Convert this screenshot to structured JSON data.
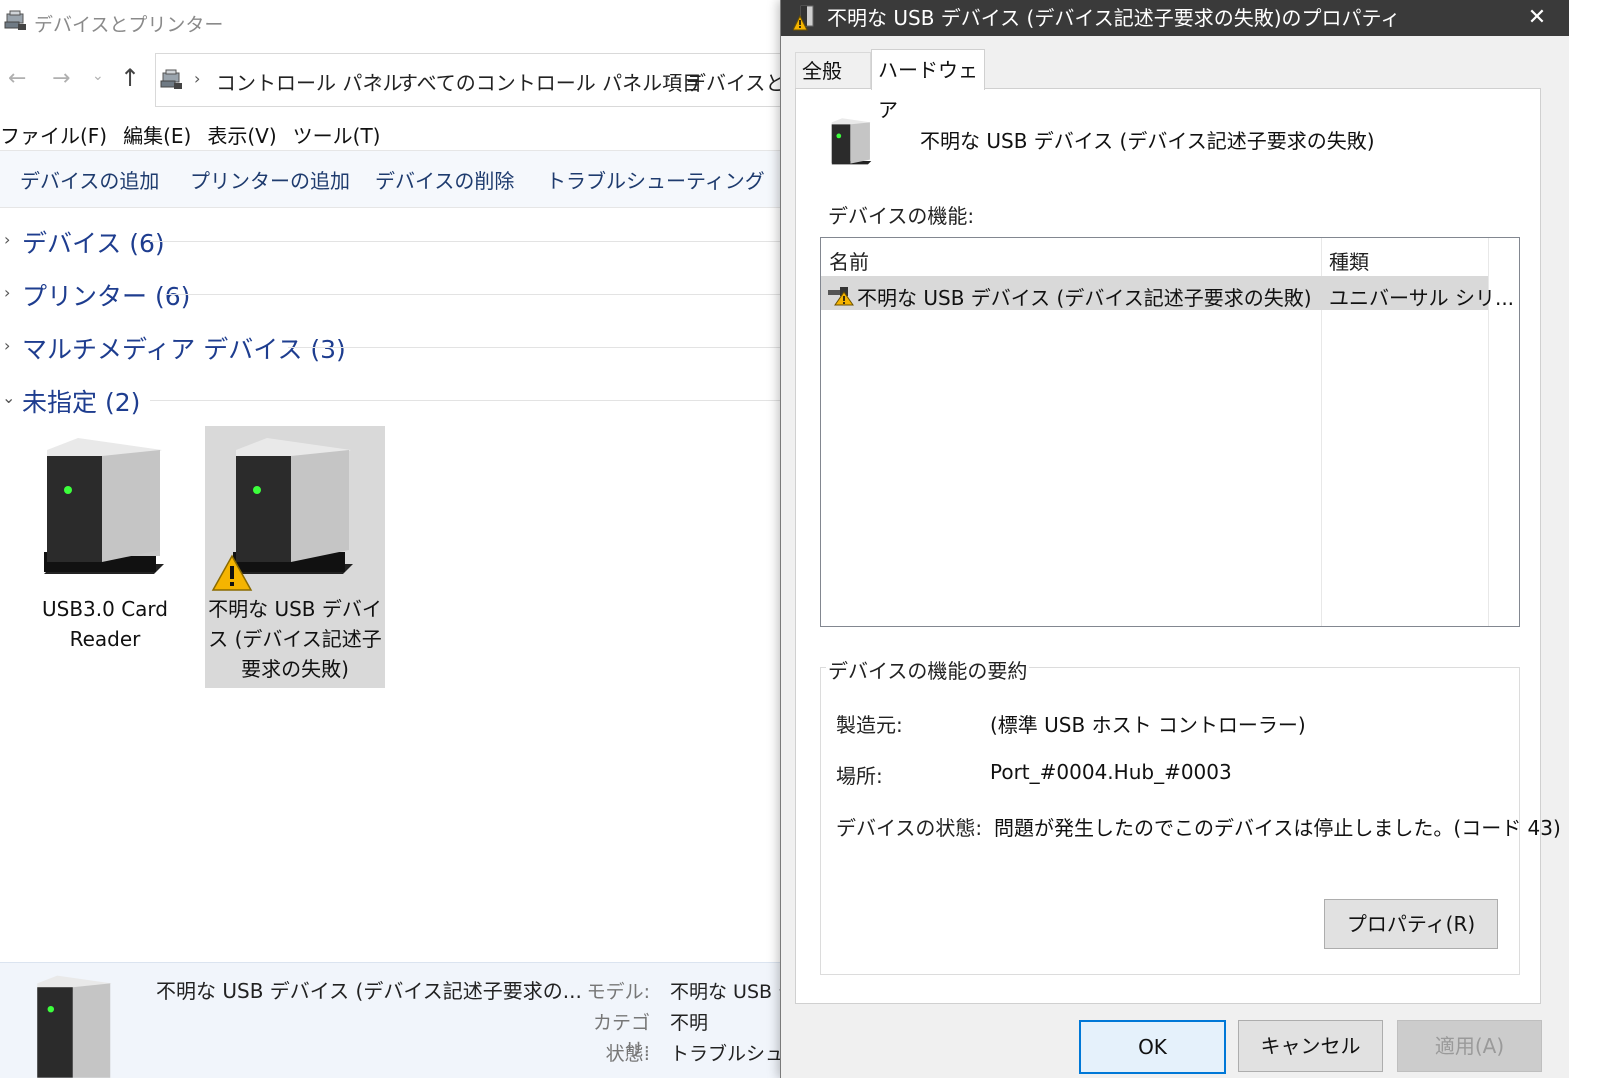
{
  "explorer": {
    "title": "デバイスとプリンター",
    "address": {
      "crumbs": [
        "コントロール パネル",
        "すべてのコントロール パネル項目",
        "デバイスとプ"
      ]
    },
    "menu": [
      "ファイル(F)",
      "編集(E)",
      "表示(V)",
      "ツール(T)"
    ],
    "commands": [
      "デバイスの追加",
      "プリンターの追加",
      "デバイスの削除",
      "トラブルシューティング"
    ],
    "groups": [
      {
        "label": "デバイス (6)",
        "expanded": false
      },
      {
        "label": "プリンター (6)",
        "expanded": false
      },
      {
        "label": "マルチメディア デバイス (3)",
        "expanded": false
      },
      {
        "label": "未指定 (2)",
        "expanded": true
      }
    ],
    "devices": [
      {
        "line1": "USB3.0 Card",
        "line2": "Reader",
        "line3": "",
        "selected": false,
        "warning": false
      },
      {
        "line1": "不明な USB デバイ",
        "line2": "ス (デバイス記述子",
        "line3": "要求の失敗)",
        "selected": true,
        "warning": true
      }
    ],
    "details": {
      "name": "不明な USB デバイス (デバイス記述子要求の...",
      "model_label": "モデル:",
      "model_value": "不明な USB デ",
      "category_label": "カテゴリ:",
      "category_value": "不明",
      "status_label": "状態:",
      "status_value": "トラブルシューテ"
    }
  },
  "dialog": {
    "title": "不明な USB デバイス (デバイス記述子要求の失敗)のプロパティ",
    "close_glyph": "✕",
    "tabs": [
      "全般",
      "ハードウェア"
    ],
    "active_tab": "ハードウェア",
    "device_name": "不明な USB デバイス (デバイス記述子要求の失敗)",
    "functions_label": "デバイスの機能:",
    "columns": [
      "名前",
      "種類"
    ],
    "rows": [
      {
        "name": "不明な USB デバイス (デバイス記述子要求の失敗)",
        "type": "ユニバーサル シリ..."
      }
    ],
    "summary": {
      "legend": "デバイスの機能の要約",
      "manufacturer_label": "製造元:",
      "manufacturer_value": "(標準 USB ホスト コントローラー)",
      "location_label": "場所:",
      "location_value": "Port_#0004.Hub_#0003",
      "status_label": "デバイスの状態:",
      "status_value": "問題が発生したのでこのデバイスは停止しました。(コード 43)"
    },
    "properties_button": "プロパティ(R)",
    "buttons": {
      "ok": "OK",
      "cancel": "キャンセル",
      "apply": "適用(A)"
    }
  },
  "colors": {
    "accent": "#0078d7",
    "group_title": "#1e3d8f",
    "dialog_titlebar": "#3a3a3a",
    "warning": "#f5b400"
  }
}
